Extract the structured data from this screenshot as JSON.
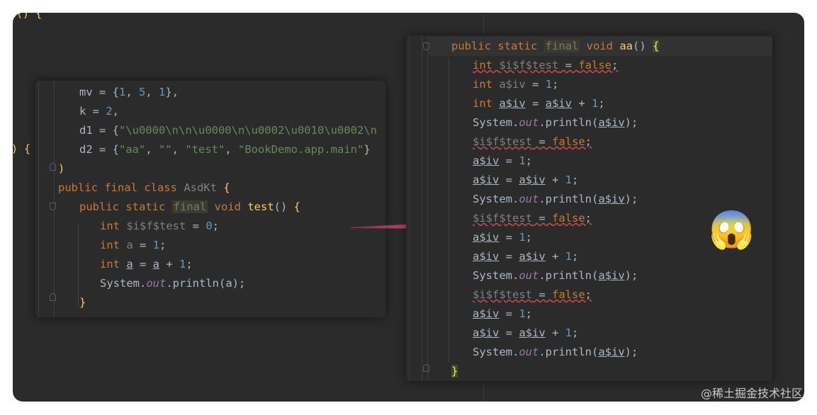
{
  "background": {
    "top_left_text": "t() {",
    "mid_left_text": ") {"
  },
  "left_panel": {
    "lines": [
      "mv = {1, 5, 1},",
      "k = 2,",
      "d1 = {\"\\u0000\\n\\n\\u0000\\n\\u0002\\u0010\\u0002\\n",
      "d2 = {\"aa\", \"\", \"test\", \"BookDemo.app.main\"}",
      ")",
      "public final class AsdKt {",
      "public static final void test() {",
      "int $i$f$test = 0;",
      "int a = 1;",
      "int a = a + 1;",
      "System.out.println(a);",
      "}"
    ]
  },
  "right_panel": {
    "header": "public static final void aa() {",
    "block_1": [
      "int $i$f$test = false;",
      "int a$iv = 1;",
      "int a$iv = a$iv + 1;",
      "System.out.println(a$iv);"
    ],
    "repeat_block": [
      "$i$f$test = false;",
      "a$iv = 1;",
      "a$iv = a$iv + 1;",
      "System.out.println(a$iv);"
    ],
    "closing": "}"
  },
  "emoji": "😱",
  "watermark": "@稀土掘金技术社区",
  "colors": {
    "keyword": "#cc7832",
    "function": "#ffc66d",
    "number": "#6897bb",
    "string": "#6a8759",
    "arrow": "#f0487c"
  }
}
